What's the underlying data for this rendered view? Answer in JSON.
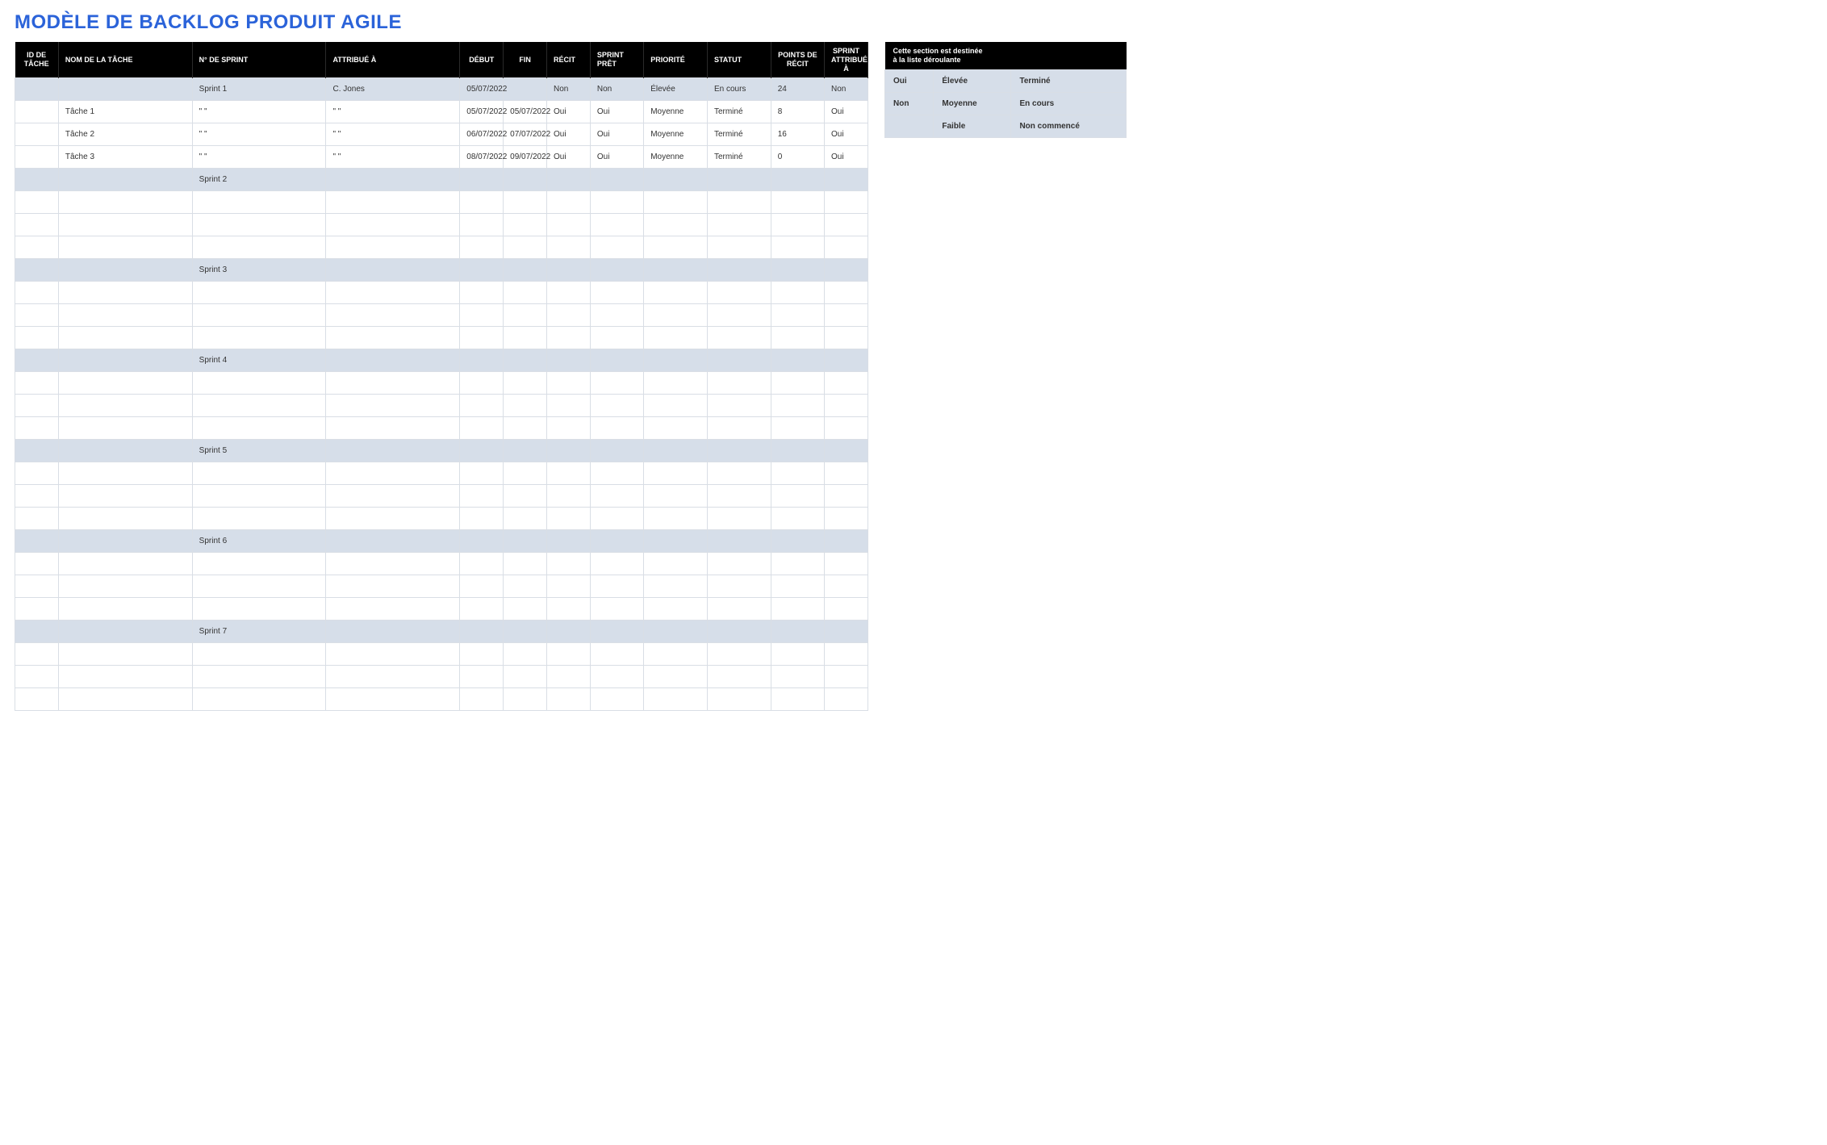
{
  "title": "MODÈLE DE BACKLOG PRODUIT AGILE",
  "headers": {
    "id": "ID DE TÂCHE",
    "name": "NOM DE LA TÂCHE",
    "sprint": "N° DE SPRINT",
    "assigned": "ATTRIBUÉ À",
    "start": "DÉBUT",
    "end": "FIN",
    "story": "RÉCIT",
    "ready": "SPRINT PRÊT",
    "priority": "PRIORITÉ",
    "status": "STATUT",
    "points": "POINTS DE RÉCIT",
    "sprint_assigned": "SPRINT ATTRIBUÉ À"
  },
  "rows": [
    {
      "type": "sprint",
      "id": "",
      "name": "",
      "sprint": "Sprint 1",
      "assigned": "C. Jones",
      "start": "05/07/2022",
      "end": "",
      "story": "Non",
      "ready": "Non",
      "priority": "Élevée",
      "status": "En cours",
      "points": "24",
      "sassign": "Non"
    },
    {
      "type": "task",
      "id": "",
      "name": "Tâche 1",
      "sprint": "\" \"",
      "assigned": "\" \"",
      "start": "05/07/2022",
      "end": "05/07/2022",
      "story": "Oui",
      "ready": "Oui",
      "priority": "Moyenne",
      "status": "Terminé",
      "points": "8",
      "sassign": "Oui"
    },
    {
      "type": "task",
      "id": "",
      "name": "Tâche 2",
      "sprint": "\" \"",
      "assigned": "\" \"",
      "start": "06/07/2022",
      "end": "07/07/2022",
      "story": "Oui",
      "ready": "Oui",
      "priority": "Moyenne",
      "status": "Terminé",
      "points": "16",
      "sassign": "Oui"
    },
    {
      "type": "task",
      "id": "",
      "name": "Tâche 3",
      "sprint": "\" \"",
      "assigned": "\" \"",
      "start": "08/07/2022",
      "end": "09/07/2022",
      "story": "Oui",
      "ready": "Oui",
      "priority": "Moyenne",
      "status": "Terminé",
      "points": "0",
      "sassign": "Oui"
    },
    {
      "type": "sprint",
      "id": "",
      "name": "",
      "sprint": "Sprint 2",
      "assigned": "",
      "start": "",
      "end": "",
      "story": "",
      "ready": "",
      "priority": "",
      "status": "",
      "points": "",
      "sassign": ""
    },
    {
      "type": "empty"
    },
    {
      "type": "empty"
    },
    {
      "type": "empty"
    },
    {
      "type": "sprint",
      "id": "",
      "name": "",
      "sprint": "Sprint 3",
      "assigned": "",
      "start": "",
      "end": "",
      "story": "",
      "ready": "",
      "priority": "",
      "status": "",
      "points": "",
      "sassign": ""
    },
    {
      "type": "empty"
    },
    {
      "type": "empty"
    },
    {
      "type": "empty"
    },
    {
      "type": "sprint",
      "id": "",
      "name": "",
      "sprint": "Sprint 4",
      "assigned": "",
      "start": "",
      "end": "",
      "story": "",
      "ready": "",
      "priority": "",
      "status": "",
      "points": "",
      "sassign": ""
    },
    {
      "type": "empty"
    },
    {
      "type": "empty"
    },
    {
      "type": "empty"
    },
    {
      "type": "sprint",
      "id": "",
      "name": "",
      "sprint": "Sprint 5",
      "assigned": "",
      "start": "",
      "end": "",
      "story": "",
      "ready": "",
      "priority": "",
      "status": "",
      "points": "",
      "sassign": ""
    },
    {
      "type": "empty"
    },
    {
      "type": "empty"
    },
    {
      "type": "empty"
    },
    {
      "type": "sprint",
      "id": "",
      "name": "",
      "sprint": "Sprint 6",
      "assigned": "",
      "start": "",
      "end": "",
      "story": "",
      "ready": "",
      "priority": "",
      "status": "",
      "points": "",
      "sassign": ""
    },
    {
      "type": "empty"
    },
    {
      "type": "empty"
    },
    {
      "type": "empty"
    },
    {
      "type": "sprint",
      "id": "",
      "name": "",
      "sprint": "Sprint 7",
      "assigned": "",
      "start": "",
      "end": "",
      "story": "",
      "ready": "",
      "priority": "",
      "status": "",
      "points": "",
      "sassign": ""
    },
    {
      "type": "empty"
    },
    {
      "type": "empty"
    },
    {
      "type": "empty"
    }
  ],
  "dropdown": {
    "header_line1": "Cette section est destinée",
    "header_line2": "à la liste déroulante",
    "rows": [
      {
        "c1": "Oui",
        "c2": "Élevée",
        "c3": "Terminé"
      },
      {
        "c1": "Non",
        "c2": "Moyenne",
        "c3": "En cours"
      },
      {
        "c1": "",
        "c2": "Faible",
        "c3": "Non commencé"
      }
    ]
  }
}
